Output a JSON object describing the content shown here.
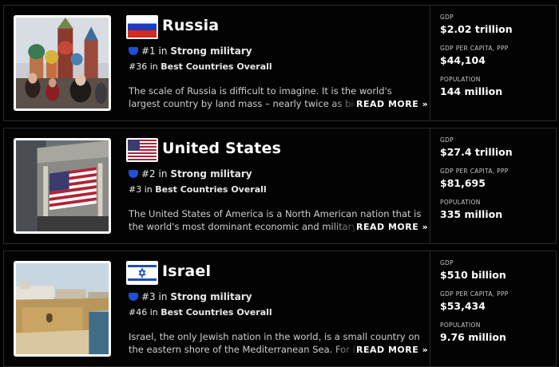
{
  "countries": [
    {
      "name": "Russia",
      "flag_icon": "russia-flag",
      "photo_icon": "st-basils-cathedral-photo",
      "rank_number": "#1",
      "rank_in": "in",
      "rank_category": "Strong military",
      "overall_rank": "#36",
      "overall_in": "in",
      "overall_category": "Best Countries Overall",
      "description": "The scale of Russia is difficult to imagine. It is the world's largest country by land mass – nearly twice as big as Canada.",
      "read_more": "READ MORE »",
      "stats": [
        {
          "label": "GDP",
          "value": "$2.02 trillion"
        },
        {
          "label": "GDP PER CAPITA, PPP",
          "value": "$44,104"
        },
        {
          "label": "POPULATION",
          "value": "144 million"
        }
      ]
    },
    {
      "name": "United States",
      "flag_icon": "us-flag",
      "photo_icon": "new-york-stock-exchange-photo",
      "rank_number": "#2",
      "rank_in": "in",
      "rank_category": "Strong military",
      "overall_rank": "#3",
      "overall_in": "in",
      "overall_category": "Best Countries Overall",
      "description": "The United States of America is a North American nation that is the world's most dominant economic and military power.",
      "read_more": "READ MORE »",
      "stats": [
        {
          "label": "GDP",
          "value": "$27.4 trillion"
        },
        {
          "label": "GDP PER CAPITA, PPP",
          "value": "$81,695"
        },
        {
          "label": "POPULATION",
          "value": "335 million"
        }
      ]
    },
    {
      "name": "Israel",
      "flag_icon": "israel-flag",
      "photo_icon": "coastal-old-city-photo",
      "rank_number": "#3",
      "rank_in": "in",
      "rank_category": "Strong military",
      "overall_rank": "#46",
      "overall_in": "in",
      "overall_category": "Best Countries Overall",
      "description": "Israel, the only Jewish nation in the world, is a small country on the eastern shore of the Mediterranean Sea. For its size,",
      "read_more": "READ MORE »",
      "stats": [
        {
          "label": "GDP",
          "value": "$510 billion"
        },
        {
          "label": "GDP PER CAPITA, PPP",
          "value": "$53,434"
        },
        {
          "label": "POPULATION",
          "value": "9.76 million"
        }
      ]
    }
  ]
}
